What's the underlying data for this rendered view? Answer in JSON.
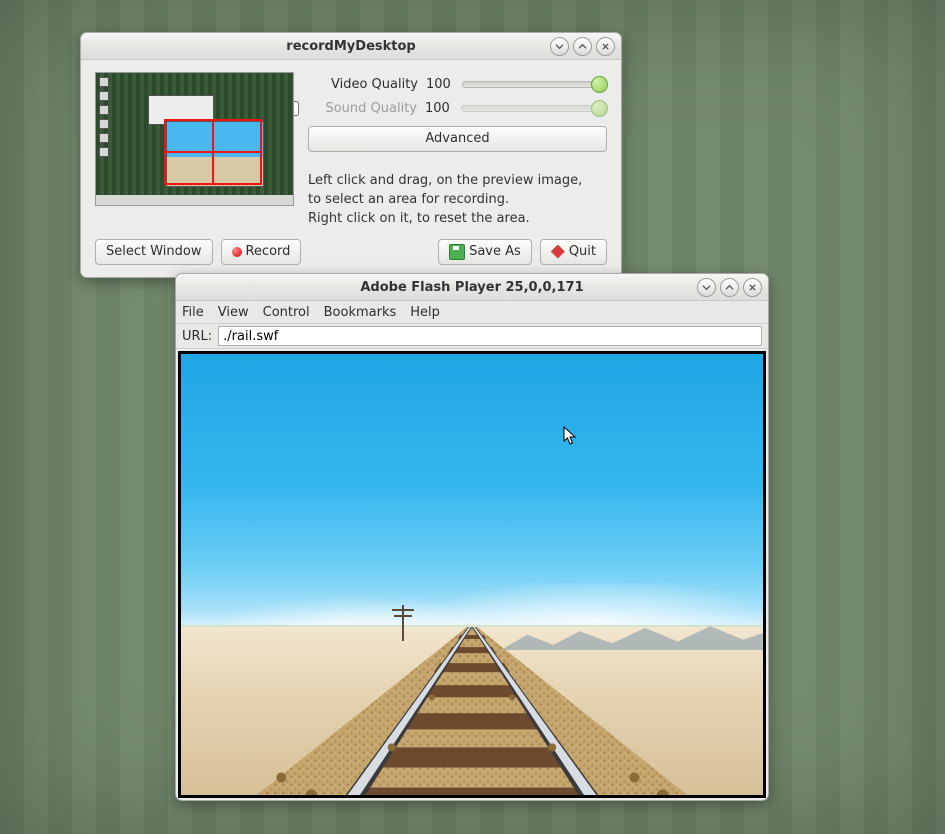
{
  "rmd": {
    "title": "recordMyDesktop",
    "video_label": "Video Quality",
    "video_value": "100",
    "sound_label": "Sound Quality",
    "sound_value": "100",
    "sound_enabled": false,
    "advanced_label": "Advanced",
    "hint_line1": "Left click and drag, on the preview image,",
    "hint_line2": "to select an area for recording.",
    "hint_line3": "Right click on it, to reset the area.",
    "select_window_label": "Select Window",
    "record_label": "Record",
    "save_as_label": "Save As",
    "quit_label": "Quit"
  },
  "flash": {
    "title": "Adobe Flash Player 25,0,0,171",
    "menu": {
      "file": "File",
      "view": "View",
      "control": "Control",
      "bookmarks": "Bookmarks",
      "help": "Help"
    },
    "url_label": "URL:",
    "url_value": "./rail.swf"
  }
}
